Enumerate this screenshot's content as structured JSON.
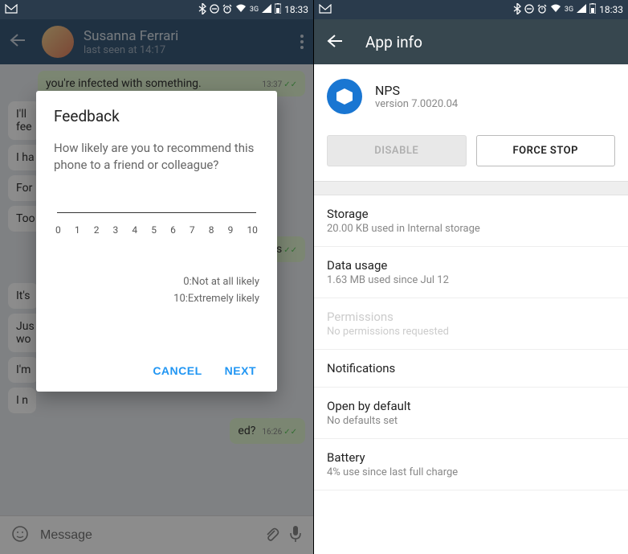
{
  "statusbar": {
    "network": "3G",
    "time": "18:33"
  },
  "left": {
    "chat": {
      "name": "Susanna Ferrari",
      "status": "last seen at 14:17",
      "msg_out1": "you're infected with something.",
      "msg_out1_time": "13:37",
      "msg1": "I'll",
      "msg1b": "fee",
      "msg2": "I ha",
      "msg3": "For",
      "msg4": "Too",
      "bubble_right1": "his",
      "msg5": "It's",
      "msg6": "Jus",
      "msg6b": "wo",
      "msg7": "I'm",
      "msg8": "I n",
      "bubble_right2": "ed?",
      "bubble_right2_time": "16:26",
      "input_placeholder": "Message"
    },
    "dialog": {
      "title": "Feedback",
      "question": "How likely are you to recommend this phone to a friend or colleague?",
      "scale": [
        "0",
        "1",
        "2",
        "3",
        "4",
        "5",
        "6",
        "7",
        "8",
        "9",
        "10"
      ],
      "legend_low": "0:Not at all likely",
      "legend_high": "10:Extremely likely",
      "cancel": "CANCEL",
      "next": "NEXT"
    }
  },
  "right": {
    "header": "App info",
    "app": {
      "name": "NPS",
      "version": "version 7.0020.04"
    },
    "buttons": {
      "disable": "DISABLE",
      "force_stop": "FORCE STOP"
    },
    "settings": {
      "storage_title": "Storage",
      "storage_sub": "20.00 KB used in Internal storage",
      "data_title": "Data usage",
      "data_sub": "1.63 MB used since Jul 12",
      "perm_title": "Permissions",
      "perm_sub": "No permissions requested",
      "notif_title": "Notifications",
      "open_title": "Open by default",
      "open_sub": "No defaults set",
      "battery_title": "Battery",
      "battery_sub": "4% use since last full charge"
    }
  }
}
